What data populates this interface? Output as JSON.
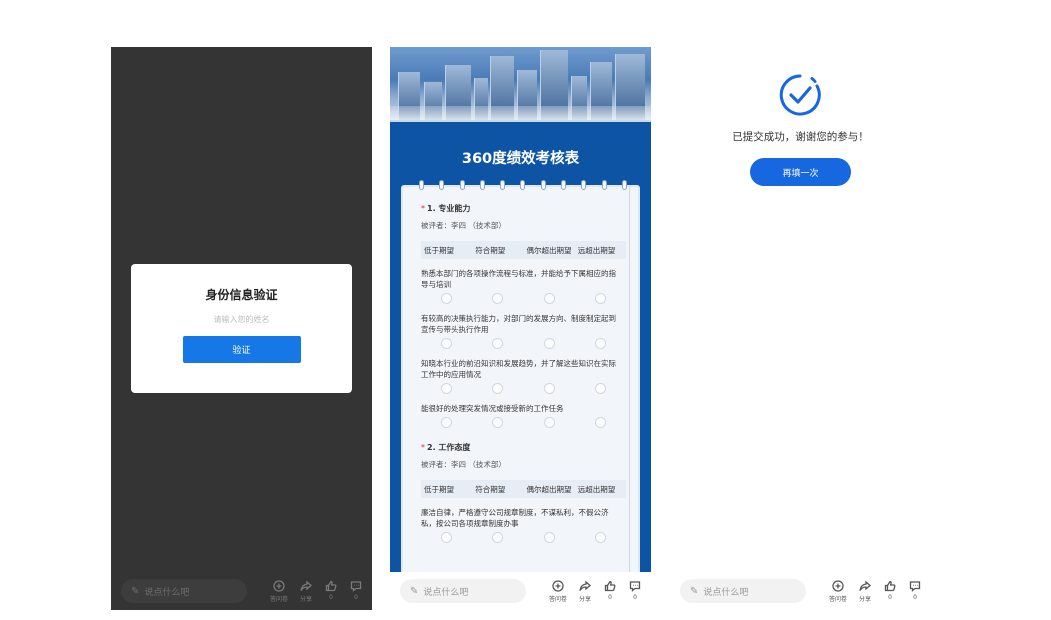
{
  "colors": {
    "primary": "#1677e6",
    "dark_bg": "#343434",
    "survey_bg": "#0d55a4",
    "required": "#e23333",
    "success": "#1667e0"
  },
  "verify_panel": {
    "title": "身份信息验证",
    "name_placeholder": "请输入您的姓名",
    "verify_label": "验证"
  },
  "survey_panel": {
    "title": "360度绩效考核表",
    "scale": [
      "低于期望",
      "符合期望",
      "偶尔超出期望",
      "远超出期望"
    ],
    "questions": [
      {
        "number": "1.",
        "title": "专业能力",
        "evaluated": "被评者：李四 （技术部）",
        "items": [
          "熟悉本部门的各项操作流程与标准，并能给予下属相应的指导与培训",
          "有较高的决策执行能力，对部门的发展方向、制度制定起到宣传与带头执行作用",
          "知晓本行业的前沿知识和发展趋势，并了解这些知识在实际工作中的应用情况",
          "能很好的处理突发情况或接受新的工作任务"
        ]
      },
      {
        "number": "2.",
        "title": "工作态度",
        "evaluated": "被评者：李四 （技术部）",
        "items": [
          "廉洁自律，严格遵守公司规章制度，不谋私利，不假公济私，按公司各项规章制度办事"
        ]
      }
    ]
  },
  "success_panel": {
    "message": "已提交成功，谢谢您的参与！",
    "refill_label": "再填一次"
  },
  "bottom_bar": {
    "comment_placeholder": "说点什么吧",
    "actions": [
      {
        "icon": "plus-circle-icon",
        "label": "答问卷"
      },
      {
        "icon": "share-icon",
        "label": "分享"
      },
      {
        "icon": "thumbs-up-icon",
        "label": "0"
      },
      {
        "icon": "comment-icon",
        "label": "0"
      }
    ]
  }
}
